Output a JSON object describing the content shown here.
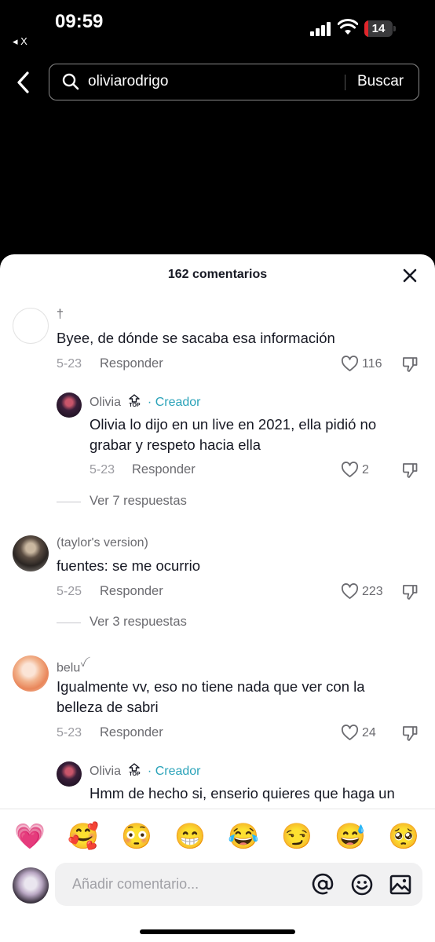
{
  "status_bar": {
    "time": "09:59",
    "back_label": "◂ X",
    "battery_level": "14",
    "battery_color": "#e0262b"
  },
  "search": {
    "query": "oliviarodrigo",
    "submit_label": "Buscar"
  },
  "comments_sheet": {
    "title": "162 comentarios",
    "comments": [
      {
        "author": "†",
        "text": "Byee, de dónde se sacaba esa información",
        "date": "5-23",
        "reply_label": "Responder",
        "likes": "116",
        "replies": [
          {
            "author": "Olivia",
            "creator_label": "· Creador",
            "top_badge": "TOP",
            "text_lines": [
              "Olivia lo dijo en un live en 2021, ella pidió no",
              "grabar y respeto hacia ella"
            ],
            "date": "5-23",
            "reply_label": "Responder",
            "likes": "2"
          }
        ],
        "view_replies": "Ver 7 respuestas"
      },
      {
        "author": "(taylor's version)",
        "text": "fuentes: se me ocurrio",
        "date": "5-25",
        "reply_label": "Responder",
        "likes": "223",
        "view_replies": "Ver 3 respuestas"
      },
      {
        "author": "belu",
        "author_suffix": "ꪜ",
        "text_lines": [
          "Igualmente vv, eso no tiene nada que ver con la",
          "belleza de sabri"
        ],
        "date": "5-23",
        "reply_label": "Responder",
        "likes": "24",
        "replies": [
          {
            "author": "Olivia",
            "creator_label": "· Creador",
            "top_badge": "TOP",
            "text_lines": [
              "Hmm de hecho si, enserio quieres que haga un"
            ]
          }
        ]
      }
    ]
  },
  "composer": {
    "emojis": [
      "💗",
      "🥰",
      "😳",
      "😁",
      "😂",
      "😏",
      "😅",
      "🥺"
    ],
    "placeholder": "Añadir comentario..."
  },
  "colors": {
    "creator_accent": "#2ba3b9",
    "text_primary": "#161823",
    "text_secondary": "#6b6b70"
  }
}
